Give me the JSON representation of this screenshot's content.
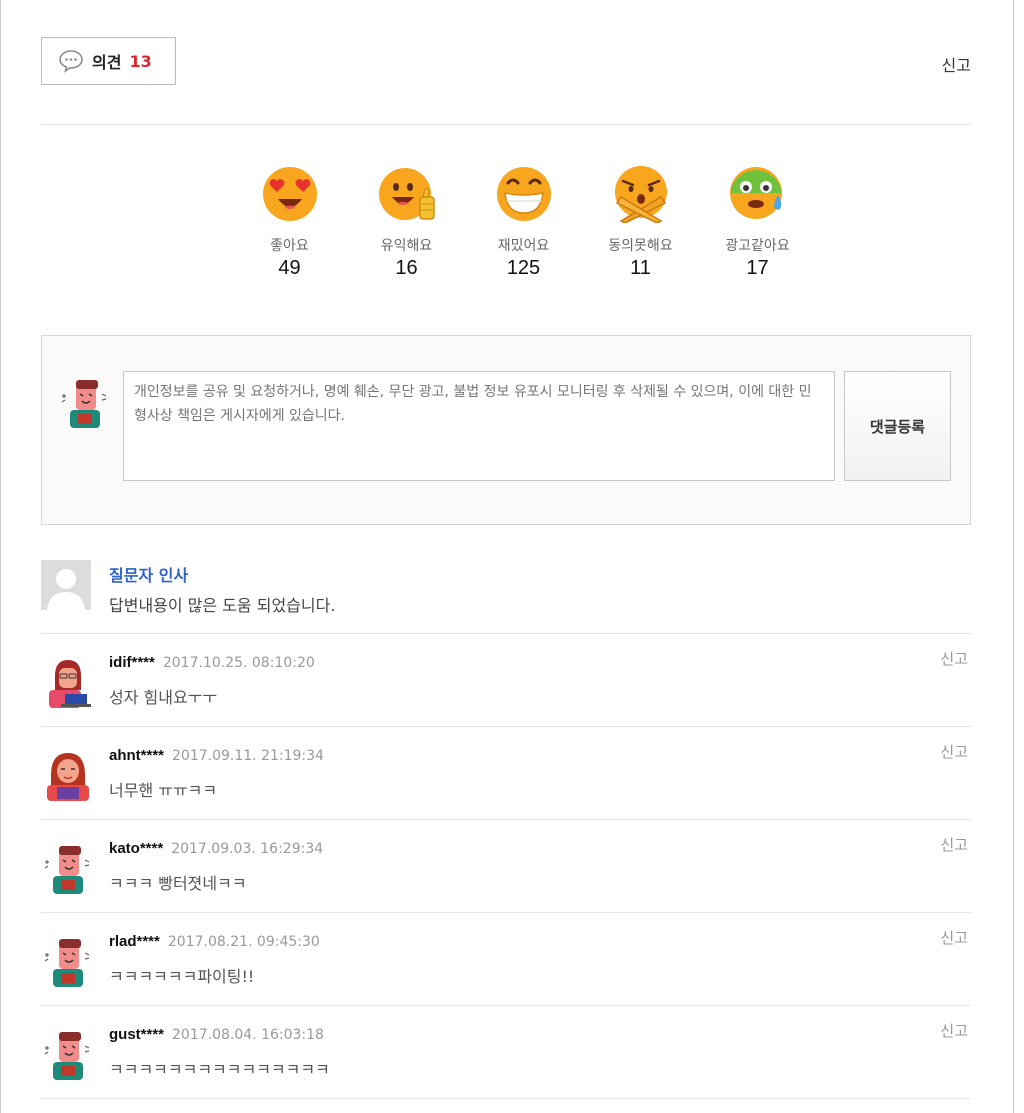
{
  "header": {
    "opinion_label": "의견",
    "opinion_count": "13",
    "report_label": "신고"
  },
  "reactions": [
    {
      "icon": "heart-eyes-icon",
      "label": "좋아요",
      "count": "49"
    },
    {
      "icon": "thumbs-up-face-icon",
      "label": "유익해요",
      "count": "16"
    },
    {
      "icon": "grin-face-icon",
      "label": "재밌어요",
      "count": "125"
    },
    {
      "icon": "crossed-arms-face-icon",
      "label": "동의못해요",
      "count": "11"
    },
    {
      "icon": "sick-face-icon",
      "label": "광고같아요",
      "count": "17"
    }
  ],
  "write": {
    "placeholder": "개인정보를 공유 및 요청하거나, 명예 훼손, 무단 광고, 불법 정보 유포시 모니터링 후 삭제될 수 있으며, 이에 대한 민형사상 책임은 게시자에게 있습니다.",
    "submit_label": "댓글등록"
  },
  "greeting": {
    "title": "질문자 인사",
    "message": "답변내용이 많은 도움 되었습니다."
  },
  "comments": [
    {
      "user": "idif****",
      "date": "2017.10.25. 08:10:20",
      "text": "성자 힘내요ㅜㅜ",
      "report": "신고",
      "avatar": "woman-laptop-avatar"
    },
    {
      "user": "ahnt****",
      "date": "2017.09.11. 21:19:34",
      "text": "너무핸 ㅠㅠㅋㅋ",
      "report": "신고",
      "avatar": "woman-book-avatar"
    },
    {
      "user": "kato****",
      "date": "2017.09.03. 16:29:34",
      "text": "ㅋㅋㅋ 빵터졋네ㅋㅋ",
      "report": "신고",
      "avatar": "man-laughing-avatar"
    },
    {
      "user": "rlad****",
      "date": "2017.08.21. 09:45:30",
      "text": "ㅋㅋㅋㅋㅋㅋ파이팅!!",
      "report": "신고",
      "avatar": "man-laughing-avatar"
    },
    {
      "user": "gust****",
      "date": "2017.08.04. 16:03:18",
      "text": "ㅋㅋㅋㅋㅋㅋㅋㅋㅋㅋㅋㅋㅋㅋㅋ",
      "report": "신고",
      "avatar": "man-laughing-avatar"
    }
  ],
  "colors": {
    "accent_red": "#e0262e",
    "link_blue": "#2f64c7",
    "emoji_yellow": "#f7a61e",
    "emoji_green": "#6fc23d"
  }
}
